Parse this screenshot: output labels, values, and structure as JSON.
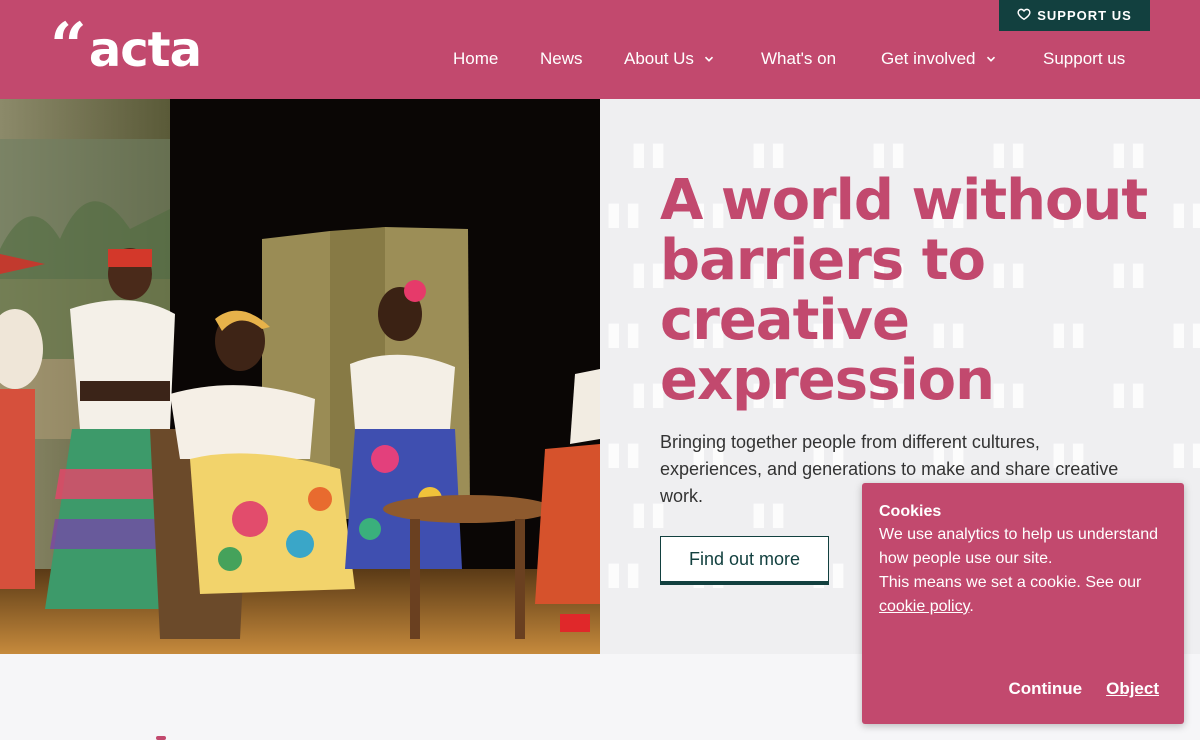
{
  "brand": {
    "logo_mark": "“",
    "logo_text": "acta",
    "primary_color": "#c2496e",
    "dark_color": "#12403f"
  },
  "support_tab": {
    "label": "SUPPORT US",
    "icon": "heart-icon"
  },
  "nav": {
    "items": [
      {
        "label": "Home"
      },
      {
        "label": "News"
      },
      {
        "label": "About Us",
        "icon": "chevron-down-icon"
      },
      {
        "label": "What's on"
      },
      {
        "label": "Get involved",
        "icon": "chevron-down-icon"
      },
      {
        "label": "Support us"
      }
    ]
  },
  "hero": {
    "title": "A world without barriers to creative expression",
    "subtitle": "Bringing together people from different cultures, experiences, and generations to make and share creative work.",
    "cta_label": "Find out more"
  },
  "cookie_banner": {
    "title": "Cookies",
    "text1": "We use analytics to help us understand how people use our site.",
    "text2_prefix": "This means we set a cookie. See our",
    "link_label": "cookie policy",
    "text2_suffix": ".",
    "continue_label": "Continue",
    "object_label": "Object"
  }
}
